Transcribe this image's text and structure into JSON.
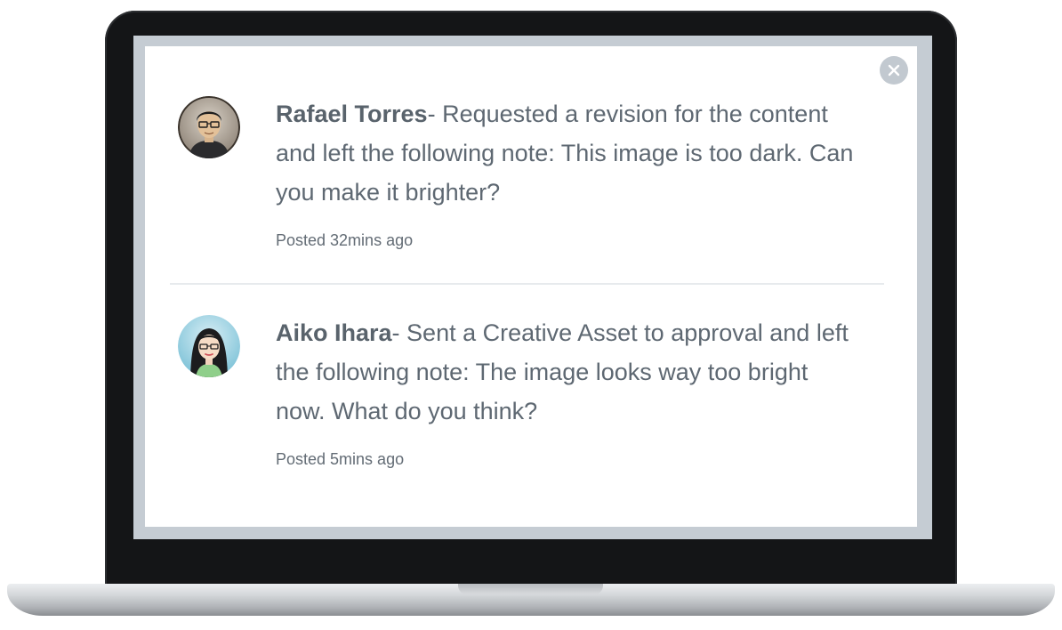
{
  "notifications": [
    {
      "author": "Rafael Torres",
      "message": "- Requested a revision for the content and left the following note: This image is too dark. Can you make it brighter?",
      "posted": "Posted 32mins ago",
      "avatar": "male-avatar-icon"
    },
    {
      "author": "Aiko Ihara",
      "message": "- Sent a Creative Asset to approval and left the following note: The image looks way too bright now. What do you think?",
      "posted": "Posted 5mins ago",
      "avatar": "female-avatar-icon"
    }
  ],
  "close_icon": "close-icon",
  "colors": {
    "bezel": "#141517",
    "screen": "#c5ccd3",
    "panel": "#ffffff",
    "text": "#5e6872",
    "close_button": "#c2c9d0"
  }
}
